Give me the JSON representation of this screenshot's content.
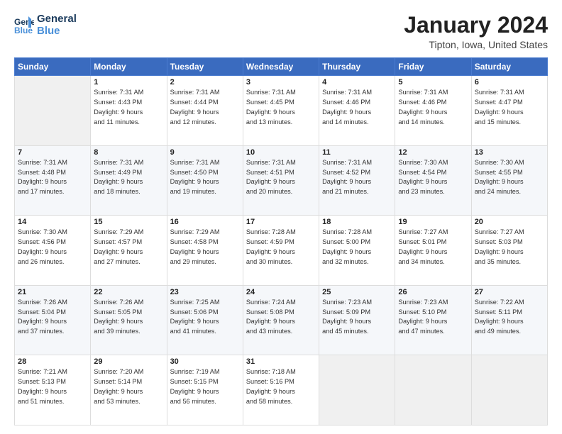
{
  "header": {
    "logo_line1": "General",
    "logo_line2": "Blue",
    "month_title": "January 2024",
    "location": "Tipton, Iowa, United States"
  },
  "days_of_week": [
    "Sunday",
    "Monday",
    "Tuesday",
    "Wednesday",
    "Thursday",
    "Friday",
    "Saturday"
  ],
  "weeks": [
    [
      {
        "day": "",
        "info": ""
      },
      {
        "day": "1",
        "info": "Sunrise: 7:31 AM\nSunset: 4:43 PM\nDaylight: 9 hours\nand 11 minutes."
      },
      {
        "day": "2",
        "info": "Sunrise: 7:31 AM\nSunset: 4:44 PM\nDaylight: 9 hours\nand 12 minutes."
      },
      {
        "day": "3",
        "info": "Sunrise: 7:31 AM\nSunset: 4:45 PM\nDaylight: 9 hours\nand 13 minutes."
      },
      {
        "day": "4",
        "info": "Sunrise: 7:31 AM\nSunset: 4:46 PM\nDaylight: 9 hours\nand 14 minutes."
      },
      {
        "day": "5",
        "info": "Sunrise: 7:31 AM\nSunset: 4:46 PM\nDaylight: 9 hours\nand 14 minutes."
      },
      {
        "day": "6",
        "info": "Sunrise: 7:31 AM\nSunset: 4:47 PM\nDaylight: 9 hours\nand 15 minutes."
      }
    ],
    [
      {
        "day": "7",
        "info": "Sunrise: 7:31 AM\nSunset: 4:48 PM\nDaylight: 9 hours\nand 17 minutes."
      },
      {
        "day": "8",
        "info": "Sunrise: 7:31 AM\nSunset: 4:49 PM\nDaylight: 9 hours\nand 18 minutes."
      },
      {
        "day": "9",
        "info": "Sunrise: 7:31 AM\nSunset: 4:50 PM\nDaylight: 9 hours\nand 19 minutes."
      },
      {
        "day": "10",
        "info": "Sunrise: 7:31 AM\nSunset: 4:51 PM\nDaylight: 9 hours\nand 20 minutes."
      },
      {
        "day": "11",
        "info": "Sunrise: 7:31 AM\nSunset: 4:52 PM\nDaylight: 9 hours\nand 21 minutes."
      },
      {
        "day": "12",
        "info": "Sunrise: 7:30 AM\nSunset: 4:54 PM\nDaylight: 9 hours\nand 23 minutes."
      },
      {
        "day": "13",
        "info": "Sunrise: 7:30 AM\nSunset: 4:55 PM\nDaylight: 9 hours\nand 24 minutes."
      }
    ],
    [
      {
        "day": "14",
        "info": "Sunrise: 7:30 AM\nSunset: 4:56 PM\nDaylight: 9 hours\nand 26 minutes."
      },
      {
        "day": "15",
        "info": "Sunrise: 7:29 AM\nSunset: 4:57 PM\nDaylight: 9 hours\nand 27 minutes."
      },
      {
        "day": "16",
        "info": "Sunrise: 7:29 AM\nSunset: 4:58 PM\nDaylight: 9 hours\nand 29 minutes."
      },
      {
        "day": "17",
        "info": "Sunrise: 7:28 AM\nSunset: 4:59 PM\nDaylight: 9 hours\nand 30 minutes."
      },
      {
        "day": "18",
        "info": "Sunrise: 7:28 AM\nSunset: 5:00 PM\nDaylight: 9 hours\nand 32 minutes."
      },
      {
        "day": "19",
        "info": "Sunrise: 7:27 AM\nSunset: 5:01 PM\nDaylight: 9 hours\nand 34 minutes."
      },
      {
        "day": "20",
        "info": "Sunrise: 7:27 AM\nSunset: 5:03 PM\nDaylight: 9 hours\nand 35 minutes."
      }
    ],
    [
      {
        "day": "21",
        "info": "Sunrise: 7:26 AM\nSunset: 5:04 PM\nDaylight: 9 hours\nand 37 minutes."
      },
      {
        "day": "22",
        "info": "Sunrise: 7:26 AM\nSunset: 5:05 PM\nDaylight: 9 hours\nand 39 minutes."
      },
      {
        "day": "23",
        "info": "Sunrise: 7:25 AM\nSunset: 5:06 PM\nDaylight: 9 hours\nand 41 minutes."
      },
      {
        "day": "24",
        "info": "Sunrise: 7:24 AM\nSunset: 5:08 PM\nDaylight: 9 hours\nand 43 minutes."
      },
      {
        "day": "25",
        "info": "Sunrise: 7:23 AM\nSunset: 5:09 PM\nDaylight: 9 hours\nand 45 minutes."
      },
      {
        "day": "26",
        "info": "Sunrise: 7:23 AM\nSunset: 5:10 PM\nDaylight: 9 hours\nand 47 minutes."
      },
      {
        "day": "27",
        "info": "Sunrise: 7:22 AM\nSunset: 5:11 PM\nDaylight: 9 hours\nand 49 minutes."
      }
    ],
    [
      {
        "day": "28",
        "info": "Sunrise: 7:21 AM\nSunset: 5:13 PM\nDaylight: 9 hours\nand 51 minutes."
      },
      {
        "day": "29",
        "info": "Sunrise: 7:20 AM\nSunset: 5:14 PM\nDaylight: 9 hours\nand 53 minutes."
      },
      {
        "day": "30",
        "info": "Sunrise: 7:19 AM\nSunset: 5:15 PM\nDaylight: 9 hours\nand 56 minutes."
      },
      {
        "day": "31",
        "info": "Sunrise: 7:18 AM\nSunset: 5:16 PM\nDaylight: 9 hours\nand 58 minutes."
      },
      {
        "day": "",
        "info": ""
      },
      {
        "day": "",
        "info": ""
      },
      {
        "day": "",
        "info": ""
      }
    ]
  ]
}
